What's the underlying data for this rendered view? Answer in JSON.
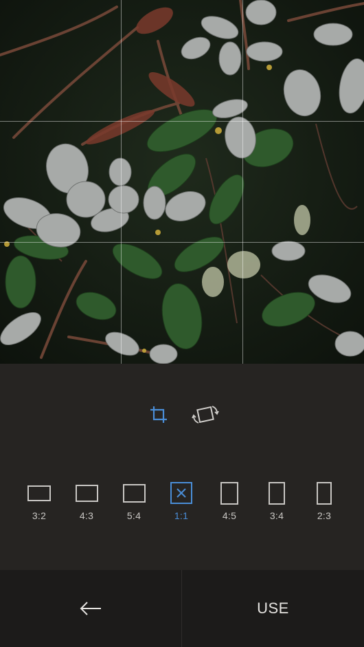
{
  "image": {
    "subject": "photo-of-leaves",
    "grid": "rule-of-thirds"
  },
  "tools": {
    "crop_icon": "crop-icon",
    "rotate_icon": "rotate-icon",
    "active_color": "#4a8ed8"
  },
  "ratios": [
    {
      "label": "3:2",
      "selected": false
    },
    {
      "label": "4:3",
      "selected": false
    },
    {
      "label": "5:4",
      "selected": false
    },
    {
      "label": "1:1",
      "selected": true
    },
    {
      "label": "4:5",
      "selected": false
    },
    {
      "label": "3:4",
      "selected": false
    },
    {
      "label": "2:3",
      "selected": false
    }
  ],
  "bottom_bar": {
    "back_icon": "arrow-left-icon",
    "use_label": "USE"
  }
}
